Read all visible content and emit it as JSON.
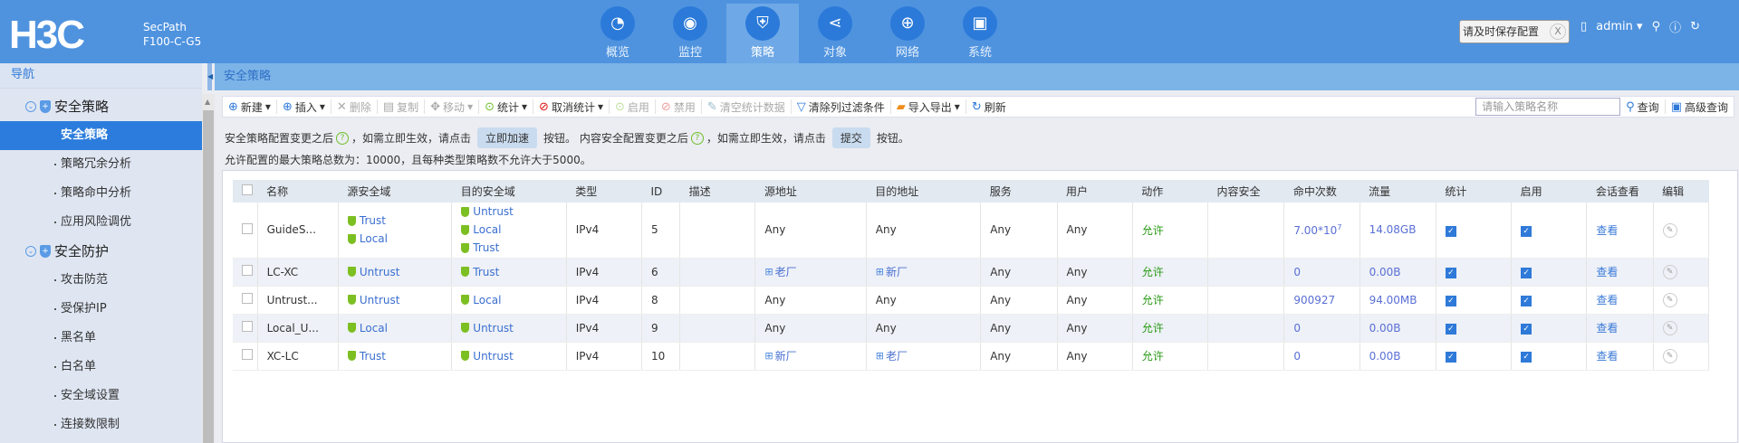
{
  "header": {
    "logo": "H3C",
    "product": "SecPath",
    "model": "F100-C-G5",
    "tabs": [
      {
        "label": "概览",
        "icon": "dashboard-icon"
      },
      {
        "label": "监控",
        "icon": "monitor-icon"
      },
      {
        "label": "策略",
        "icon": "shield-icon",
        "active": true
      },
      {
        "label": "对象",
        "icon": "share-icon"
      },
      {
        "label": "网络",
        "icon": "globe-icon"
      },
      {
        "label": "系统",
        "icon": "system-icon"
      }
    ],
    "tooltip": "请及时保存配置",
    "tooltip_close": "X",
    "user": "admin"
  },
  "sidebar": {
    "title": "导航",
    "groups": [
      {
        "label": "安全策略",
        "items": [
          "安全策略",
          "策略冗余分析",
          "策略命中分析",
          "应用风险调优"
        ]
      },
      {
        "label": "安全防护",
        "items": [
          "攻击防范",
          "受保护IP",
          "黑名单",
          "白名单",
          "安全域设置",
          "连接数限制"
        ]
      }
    ]
  },
  "breadcrumb": "安全策略",
  "toolbar": {
    "new": "新建",
    "insert": "插入",
    "delete": "删除",
    "copy": "复制",
    "move": "移动",
    "stats": "统计",
    "cancel_stats": "取消统计",
    "enable": "启用",
    "disable": "禁用",
    "clear_stats": "清空统计数据",
    "clear_filter": "清除列过滤条件",
    "import_export": "导入导出",
    "refresh": "刷新",
    "search_placeholder": "请输入策略名称",
    "query": "查询",
    "advanced_query": "高级查询"
  },
  "notice": {
    "a": "安全策略配置变更之后",
    "b": "，如需立即生效，请点击",
    "btn1": "立即加速",
    "c": "按钮。 内容安全配置变更之后",
    "d": "，如需立即生效，请点击",
    "btn2": "提交",
    "e": "按钮。",
    "limit": "允许配置的最大策略总数为：10000，且每种类型策略数不允许大于5000。"
  },
  "table": {
    "headers": [
      "",
      "名称",
      "源安全域",
      "目的安全域",
      "类型",
      "ID",
      "描述",
      "源地址",
      "目的地址",
      "服务",
      "用户",
      "动作",
      "内容安全",
      "命中次数",
      "流量",
      "统计",
      "启用",
      "会话查看",
      "编辑"
    ],
    "rows": [
      {
        "name": "GuideS...",
        "src_zone": [
          "Trust",
          "Local"
        ],
        "dst_zone": [
          "Untrust",
          "Local",
          "Trust"
        ],
        "type": "IPv4",
        "id": "5",
        "desc": "",
        "src_addr": "Any",
        "dst_addr": "Any",
        "src_group": false,
        "dst_group": false,
        "service": "Any",
        "user": "Any",
        "action": "允许",
        "content": "",
        "hits": "7.00*10",
        "hits_exp": "7",
        "traffic": "14.08GB",
        "stats": true,
        "enabled": true,
        "session": "查看"
      },
      {
        "name": "LC-XC",
        "src_zone": [
          "Untrust"
        ],
        "dst_zone": [
          "Trust"
        ],
        "type": "IPv4",
        "id": "6",
        "desc": "",
        "src_addr": "老厂",
        "dst_addr": "新厂",
        "src_group": true,
        "dst_group": true,
        "service": "Any",
        "user": "Any",
        "action": "允许",
        "content": "",
        "hits": "0",
        "hits_exp": "",
        "traffic": "0.00B",
        "stats": true,
        "enabled": true,
        "session": "查看"
      },
      {
        "name": "Untrust...",
        "src_zone": [
          "Untrust"
        ],
        "dst_zone": [
          "Local"
        ],
        "type": "IPv4",
        "id": "8",
        "desc": "",
        "src_addr": "Any",
        "dst_addr": "Any",
        "src_group": false,
        "dst_group": false,
        "service": "Any",
        "user": "Any",
        "action": "允许",
        "content": "",
        "hits": "900927",
        "hits_exp": "",
        "traffic": "94.00MB",
        "stats": true,
        "enabled": true,
        "session": "查看"
      },
      {
        "name": "Local_U...",
        "src_zone": [
          "Local"
        ],
        "dst_zone": [
          "Untrust"
        ],
        "type": "IPv4",
        "id": "9",
        "desc": "",
        "src_addr": "Any",
        "dst_addr": "Any",
        "src_group": false,
        "dst_group": false,
        "service": "Any",
        "user": "Any",
        "action": "允许",
        "content": "",
        "hits": "0",
        "hits_exp": "",
        "traffic": "0.00B",
        "stats": true,
        "enabled": true,
        "session": "查看"
      },
      {
        "name": "XC-LC",
        "src_zone": [
          "Trust"
        ],
        "dst_zone": [
          "Untrust"
        ],
        "type": "IPv4",
        "id": "10",
        "desc": "",
        "src_addr": "新厂",
        "dst_addr": "老厂",
        "src_group": true,
        "dst_group": true,
        "service": "Any",
        "user": "Any",
        "action": "允许",
        "content": "",
        "hits": "0",
        "hits_exp": "",
        "traffic": "0.00B",
        "stats": true,
        "enabled": true,
        "session": "查看"
      }
    ]
  }
}
